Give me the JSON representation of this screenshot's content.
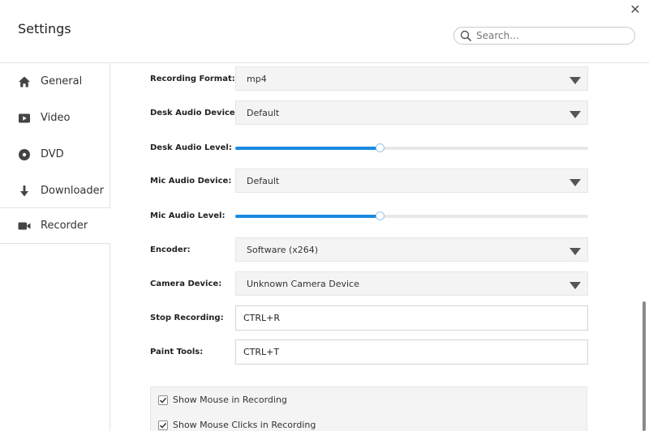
{
  "window": {
    "title": "Settings",
    "close_glyph": "✕"
  },
  "search": {
    "placeholder": "Search..."
  },
  "sidebar": {
    "items": [
      {
        "label": "General",
        "icon": "home-icon"
      },
      {
        "label": "Video",
        "icon": "video-icon"
      },
      {
        "label": "DVD",
        "icon": "disc-icon"
      },
      {
        "label": "Downloader",
        "icon": "download-icon"
      },
      {
        "label": "Recorder",
        "icon": "camera-icon",
        "active": true
      }
    ]
  },
  "recorder": {
    "recording_format": {
      "label": "Recording Format:",
      "value": "mp4"
    },
    "desk_audio_device": {
      "label": "Desk Audio Device:",
      "value": "Default"
    },
    "desk_audio_level": {
      "label": "Desk Audio Level:",
      "fraction": 0.41
    },
    "mic_audio_device": {
      "label": "Mic Audio Device:",
      "value": "Default"
    },
    "mic_audio_level": {
      "label": "Mic Audio Level:",
      "fraction": 0.41
    },
    "encoder": {
      "label": "Encoder:",
      "value": "Software (x264)"
    },
    "camera_device": {
      "label": "Camera Device:",
      "value": "Unknown Camera Device"
    },
    "stop_recording": {
      "label": "Stop Recording:",
      "value": "CTRL+R"
    },
    "paint_tools": {
      "label": "Paint Tools:",
      "value": "CTRL+T"
    },
    "checkboxes": [
      {
        "label": "Show Mouse in Recording",
        "checked": true
      },
      {
        "label": "Show Mouse Clicks in Recording",
        "checked": true
      }
    ]
  },
  "colors": {
    "accent": "#1a8ae0",
    "track": "#e8e8e8",
    "field_bg": "#f4f4f4"
  }
}
